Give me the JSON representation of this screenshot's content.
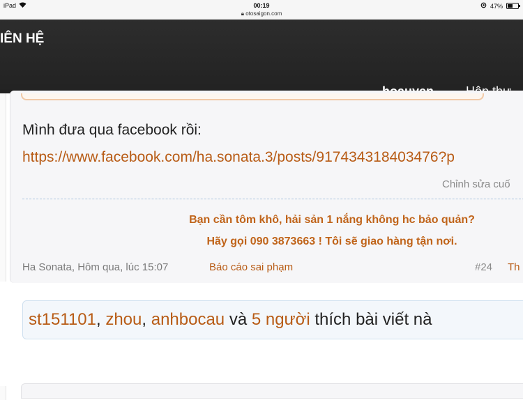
{
  "status_bar": {
    "device": "iPad",
    "time": "00:19",
    "url": "otosaigon.com",
    "battery": "47%",
    "battery_level": 0.47
  },
  "nav": {
    "contact_label": "IÊN HỆ",
    "username": "hoauyen",
    "inbox_label": "Hộp thư"
  },
  "post": {
    "text": "Mình đưa qua facebook rồi:",
    "link": "https://www.facebook.com/ha.sonata.3/posts/917434318403476?p",
    "edited": "Chỉnh sửa cuố",
    "signature_line1": "Bạn cần tôm khô, hải sản 1 nắng không hc bảo quản?",
    "signature_line2": "Hãy gọi 090 3873663 ! Tôi sẽ giao hàng tận nơi.",
    "author_time": "Ha Sonata, Hôm qua, lúc 15:07",
    "report_label": "Báo cáo sai phạm",
    "post_number": "#24",
    "like_label": "Th"
  },
  "likes": {
    "user1": "st151101",
    "sep1": ", ",
    "user2": "zhou",
    "sep2": ", ",
    "user3": "anhbocau",
    "and_text": " và ",
    "others": "5 người",
    "tail": " thích bài viết nà"
  },
  "colors": {
    "accent": "#b85c16",
    "signature": "#c0641a",
    "navbar": "#262626"
  }
}
